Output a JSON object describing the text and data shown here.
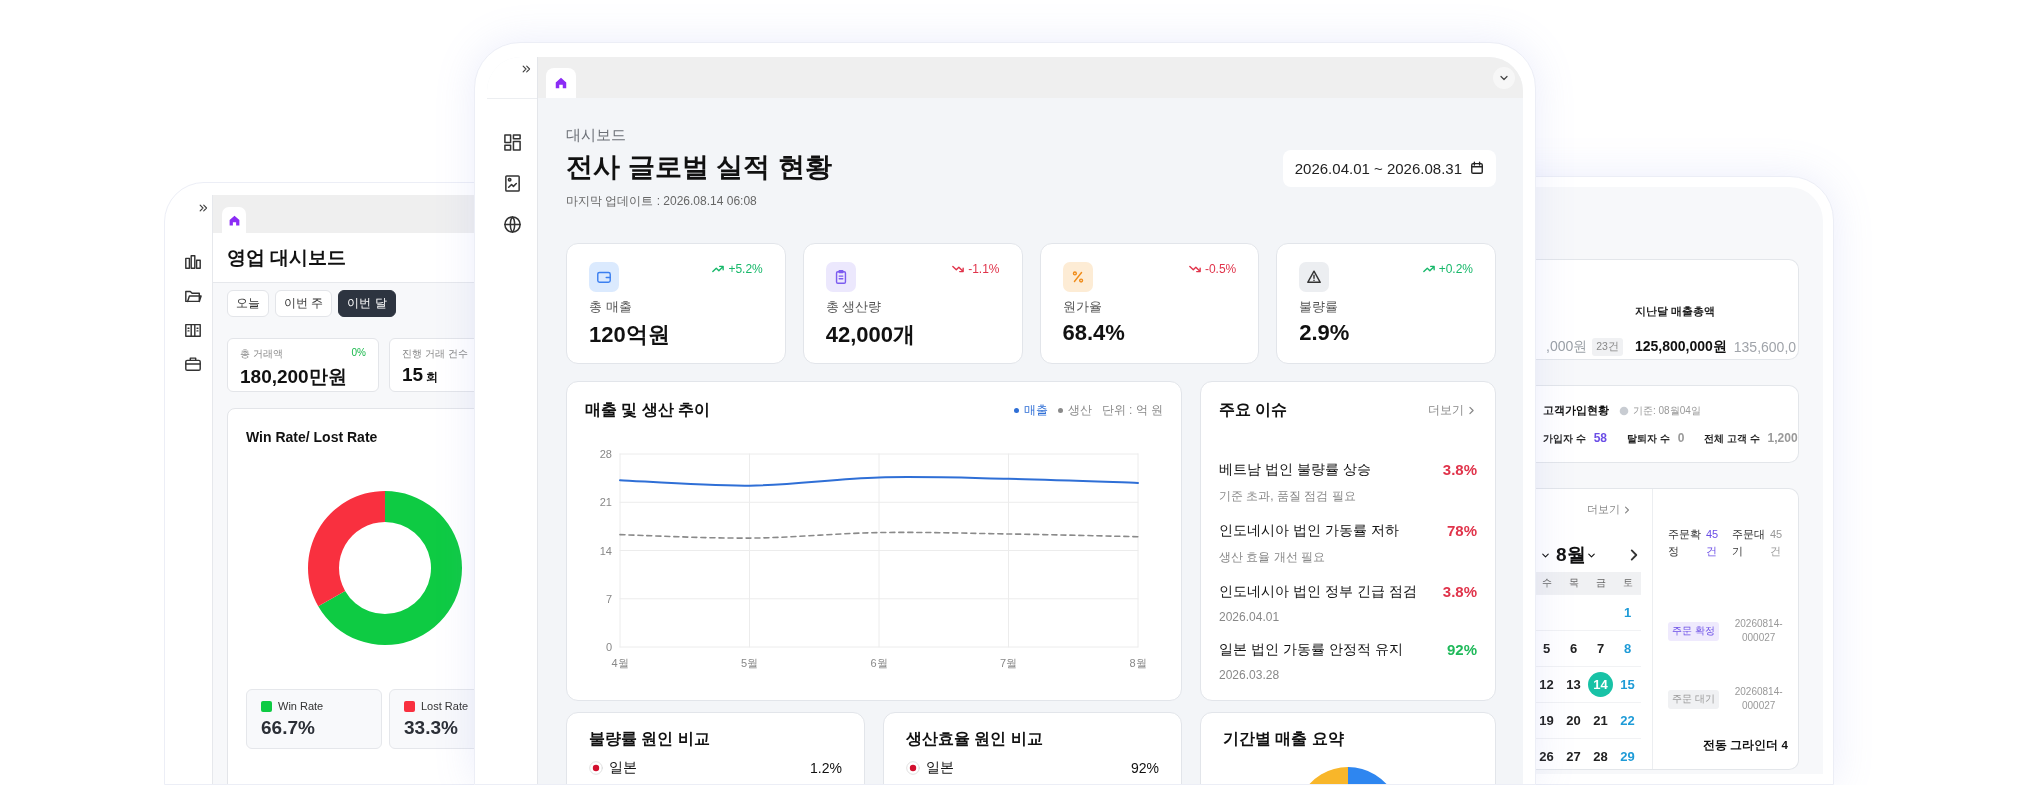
{
  "left_window": {
    "title": "영업 대시보드",
    "periods": [
      {
        "label": "오늘",
        "selected": false
      },
      {
        "label": "이번 주",
        "selected": false
      },
      {
        "label": "이번 달",
        "selected": true
      }
    ],
    "kpis": [
      {
        "label": "총 거래액",
        "value": "180,200만원",
        "change": "0%"
      },
      {
        "label": "진행 거래 건수",
        "value": "15",
        "unit": "회"
      }
    ],
    "winloss": {
      "chart_data": {
        "type": "donut",
        "title": "Win Rate/ Lost Rate",
        "categories": [
          "Win Rate",
          "Lost Rate"
        ],
        "values": [
          66.7,
          33.3
        ]
      },
      "legend": [
        {
          "color": "#0ecb43",
          "value": "66.7%"
        },
        {
          "color": "#f9303f",
          "value": "33.3%"
        }
      ]
    }
  },
  "main_window": {
    "breadcrumb": "대시보드",
    "title": "전사 글로벌 실적 현황",
    "updated": "마지막 업데이트 : 2026.08.14 06:08",
    "date_range": "2026.04.01 ~ 2026.08.31",
    "kpis": [
      {
        "kind": "wallet",
        "label": "총 매출",
        "value": "120억원",
        "change": "+5.2%",
        "rising": true
      },
      {
        "kind": "clipboard",
        "label": "총 생산량",
        "value": "42,000개",
        "change": "-1.1%",
        "rising": false
      },
      {
        "kind": "percent",
        "label": "원가율",
        "value": "68.4%",
        "change": "-0.5%",
        "rising": false
      },
      {
        "kind": "warning",
        "label": "불량률",
        "value": "2.9%",
        "change": "+0.2%",
        "rising": true
      }
    ],
    "trend_card": {
      "unit": "단위 : 억 원",
      "chart_data": {
        "type": "line",
        "title": "매출 및 생산 추이",
        "categories": [
          "4월",
          "5월",
          "6월",
          "7월",
          "8월"
        ],
        "series": [
          {
            "name": "매출",
            "color": "#2f6fd6",
            "line_style": "solid",
            "values": [
              24.2,
              23.4,
              24.6,
              24.4,
              23.8
            ]
          },
          {
            "name": "생산",
            "color": "#8a8a8a",
            "line_style": "dashed",
            "values": [
              16.3,
              15.8,
              16.6,
              16.4,
              16.0
            ]
          }
        ],
        "ylim": [
          0,
          28
        ],
        "yticks": [
          0,
          7,
          14,
          21,
          28
        ],
        "grid": true,
        "legend": "top-right"
      }
    },
    "issues": {
      "title": "주요 이슈",
      "more": "더보기",
      "items": [
        {
          "title": "베트남 법인 불량률 상승",
          "value": "3.8%",
          "color": "#e0334a",
          "note": "기준 초과, 품질 점검 필요"
        },
        {
          "title": "인도네시아 법인 가동률 저하",
          "value": "78%",
          "color": "#e0334a",
          "note": "생산 효율 개선 필요"
        },
        {
          "title": "인도네시아 법인 정부 긴급 점검",
          "value": "3.8%",
          "color": "#e0334a",
          "note": "2026.04.01"
        },
        {
          "title": "일본 법인 가동률 안정적 유지",
          "value": "92%",
          "color": "#1fb95a",
          "note": "2026.03.28"
        }
      ]
    },
    "bottom_cards": [
      {
        "kind": "list",
        "title": "불량률 원인 비교",
        "rows": [
          {
            "country": "일본",
            "value": "1.2%"
          }
        ]
      },
      {
        "kind": "list",
        "title": "생산효율 원인 비교",
        "rows": [
          {
            "country": "일본",
            "value": "92%"
          }
        ]
      },
      {
        "kind": "pie",
        "title": "기간별 매출 요약"
      }
    ]
  },
  "right_window": {
    "sales_card": {
      "partial_amount": ",000원",
      "partial_count": "23건",
      "label": "지난달 매출총액",
      "amount": "125,800,000원",
      "compare": "135,600,0"
    },
    "signup_card": {
      "title": "고객가입현황",
      "basis": "기준: 08월04일",
      "stats": [
        {
          "label": "가입자 수",
          "value": "58",
          "kind": "accent"
        },
        {
          "label": "탈퇴자 수",
          "value": "0",
          "kind": "muted"
        },
        {
          "label": "전체 고객 수",
          "value": "1,200",
          "kind": "muted"
        }
      ]
    },
    "calendar": {
      "more": "더보기",
      "month": "8월",
      "weekdays": [
        "수",
        "목",
        "금",
        "토"
      ],
      "weeks": [
        [
          {
            "day": "1",
            "selected": false
          }
        ],
        [
          {
            "day": "5",
            "selected": false
          },
          {
            "day": "6",
            "selected": false
          },
          {
            "day": "7",
            "selected": false
          },
          {
            "day": "8",
            "selected": false
          }
        ],
        [
          {
            "day": "12",
            "selected": false
          },
          {
            "day": "13",
            "selected": false
          },
          {
            "day": "14",
            "selected": true
          },
          {
            "day": "15",
            "selected": false
          }
        ],
        [
          {
            "day": "19",
            "selected": false
          },
          {
            "day": "20",
            "selected": false
          },
          {
            "day": "21",
            "selected": false
          },
          {
            "day": "22",
            "selected": false
          }
        ],
        [
          {
            "day": "26",
            "selected": false
          },
          {
            "day": "27",
            "selected": false
          },
          {
            "day": "28",
            "selected": false
          },
          {
            "day": "29",
            "selected": false
          }
        ]
      ]
    },
    "orders": {
      "stats": [
        {
          "label": "주문확정",
          "value": "45건",
          "kind": "confirmed"
        },
        {
          "label": "주문대기",
          "value": "45건",
          "kind": "pending"
        }
      ],
      "rows": [
        {
          "status": "주문 확정",
          "kind": "confirmed",
          "number": "20260814-000027"
        },
        {
          "status": "주문 대기",
          "kind": "pending",
          "number": "20260814-000027"
        }
      ],
      "product": "전동 그라인더 4"
    }
  }
}
